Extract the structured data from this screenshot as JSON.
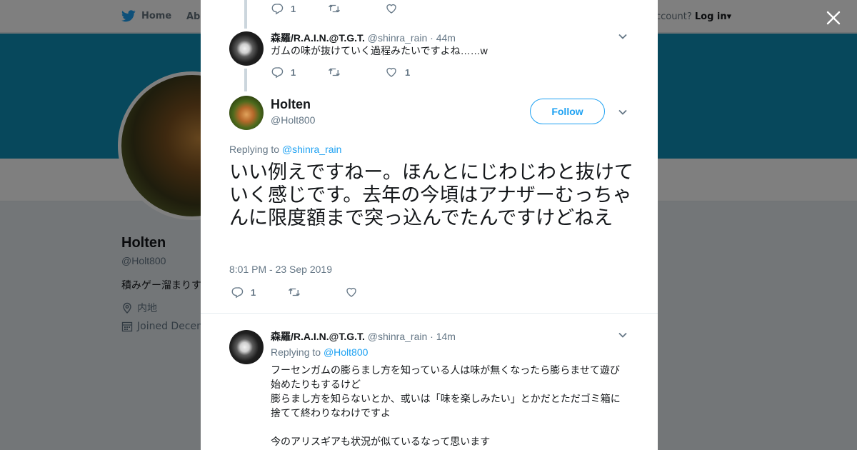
{
  "nav": {
    "home": "Home",
    "about": "Abo",
    "account_prompt": "ccount?",
    "login": "Log in"
  },
  "profile": {
    "name": "Holten",
    "handle": "@Holt800",
    "bio": "積みゲー溜まりす",
    "location": "内地",
    "joined": "Joined Decem"
  },
  "thread": {
    "top_actions": {
      "replies": "1",
      "retweets": "",
      "likes": ""
    },
    "reply1": {
      "name": "森羅/R.A.I.N.@T.G.T.",
      "handle": "@shinra_rain",
      "time": "· 44m",
      "text": "ガムの味が抜けていく過程みたいですよね……w",
      "replies": "1",
      "retweets": "",
      "likes": "1"
    }
  },
  "main_tweet": {
    "name": "Holten",
    "handle": "@Holt800",
    "follow_label": "Follow",
    "replying_prefix": "Replying to",
    "replying_to": "@shinra_rain",
    "text": "いい例えですねー。ほんとにじわじわと抜けていく感じです。去年の今頃はアナザーむっちゃんに限度額まで突っ込んでたんですけどねえ",
    "timestamp": "8:01 PM - 23 Sep 2019",
    "replies": "1",
    "retweets": "",
    "likes": ""
  },
  "reply2": {
    "name": "森羅/R.A.I.N.@T.G.T.",
    "handle": "@shinra_rain",
    "time": "· 14m",
    "replying_prefix": "Replying to",
    "replying_to": "@Holt800",
    "line1": "フーセンガムの膨らまし方を知っている人は味が無くなったら膨らませて遊び",
    "line2": "始めたりもするけど",
    "line3": "膨らまし方を知らないとか、或いは「味を楽しみたい」とかだとただゴミ箱に",
    "line4": "捨てて終わりなわけですよ",
    "line5": "今のアリスギアも状況が似ているなって思います"
  },
  "colors": {
    "brand": "#1da1f2",
    "banner": "#0f90b8",
    "muted": "#657786",
    "overlay": "rgba(0,0,0,0.5)"
  },
  "icons": [
    "twitter-bird-icon",
    "caret-down-icon",
    "close-icon",
    "location-pin-icon",
    "calendar-icon",
    "reply-icon",
    "retweet-icon",
    "heart-icon",
    "chevron-down-icon"
  ]
}
